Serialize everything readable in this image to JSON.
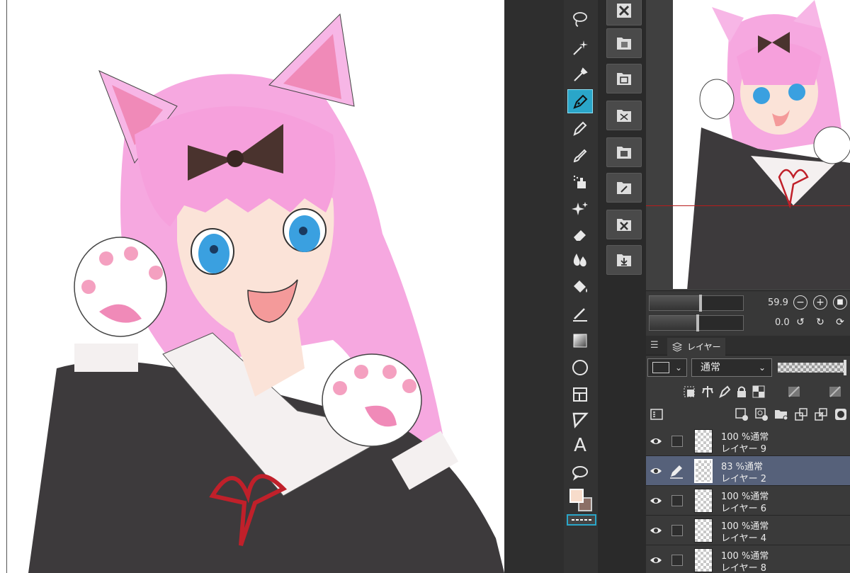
{
  "palette_colors": {
    "accent": "#2aa6c9",
    "main_color": "#f7dccb",
    "sub_color": "#8b6f66",
    "selected_layer": "#56617a"
  },
  "tools": [
    "lasso-icon",
    "magic-wand-icon",
    "eyedropper-icon",
    "pen-icon",
    "pencil-icon",
    "brush-icon",
    "airbrush-icon",
    "decoration-icon",
    "eraser-icon",
    "blend-icon",
    "fill-icon",
    "ruler-icon",
    "gradient-icon",
    "figure-icon",
    "frame-icon",
    "line-icon",
    "text-icon",
    "balloon-icon"
  ],
  "text_tool_glyph": "A",
  "commands": [
    "clear-icon",
    "fill-canvas-icon",
    "layer-settings-icon",
    "transform-icon",
    "layer-mask-icon",
    "edit-icon",
    "clear-selection-icon",
    "import-icon"
  ],
  "navigator": {
    "zoom_value": "59.9",
    "rotate_value": "0.0",
    "zoom_out_glyph": "−",
    "zoom_in_glyph": "+",
    "fit_glyph": "■",
    "rotate_left_glyph": "↺",
    "rotate_right_glyph": "↻",
    "reset_glyph": "⟳"
  },
  "layer_panel": {
    "tab_menu_glyph": "☰",
    "tab_label": "レイヤー",
    "blend_mode": "通常",
    "chevron": "⌄",
    "layers": [
      {
        "mode": "100 %通常",
        "name": "レイヤー 9",
        "selected": false
      },
      {
        "mode": "83 %通常",
        "name": "レイヤー 2",
        "selected": true
      },
      {
        "mode": "100 %通常",
        "name": "レイヤー 6",
        "selected": false
      },
      {
        "mode": "100 %通常",
        "name": "レイヤー 4",
        "selected": false
      },
      {
        "mode": "100 %通常",
        "name": "レイヤー 8",
        "selected": false
      }
    ]
  }
}
